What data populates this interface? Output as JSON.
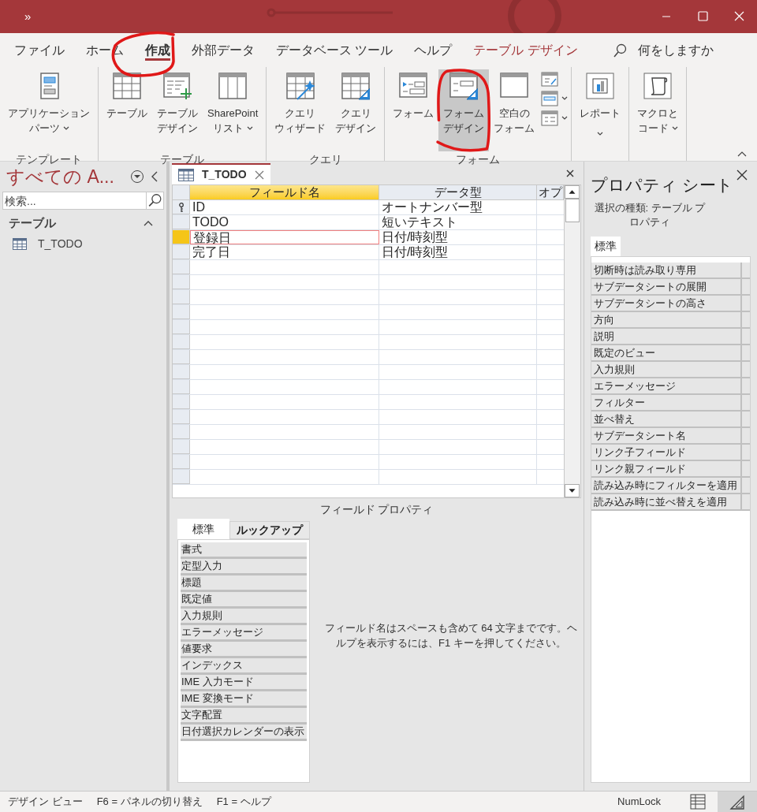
{
  "title_bar": {
    "quick_access": "»"
  },
  "ribbon_tabs": [
    {
      "label": "ファイル",
      "selected": false,
      "kind": "normal"
    },
    {
      "label": "ホーム",
      "selected": false,
      "kind": "normal"
    },
    {
      "label": "作成",
      "selected": true,
      "kind": "normal"
    },
    {
      "label": "外部データ",
      "selected": false,
      "kind": "normal"
    },
    {
      "label": "データベース ツール",
      "selected": false,
      "kind": "normal"
    },
    {
      "label": "ヘルプ",
      "selected": false,
      "kind": "normal"
    },
    {
      "label": "テーブル デザイン",
      "selected": false,
      "kind": "contextual"
    }
  ],
  "tell_me": "何をしますか",
  "ribbon_groups": [
    {
      "label": "テンプレート",
      "commands": [
        {
          "kind": "app-parts",
          "lines": [
            "アプリケーション",
            "パーツ"
          ],
          "dropdown": true,
          "highlighted": false
        }
      ]
    },
    {
      "label": "テーブル",
      "commands": [
        {
          "kind": "table",
          "lines": [
            "テーブル"
          ],
          "dropdown": false,
          "highlighted": false
        },
        {
          "kind": "table-design",
          "lines": [
            "テーブル",
            "デザイン"
          ],
          "dropdown": false,
          "highlighted": false
        },
        {
          "kind": "sharepoint",
          "lines": [
            "SharePoint",
            "リスト"
          ],
          "dropdown": true,
          "highlighted": false
        }
      ]
    },
    {
      "label": "クエリ",
      "commands": [
        {
          "kind": "query-wizard",
          "lines": [
            "クエリ",
            "ウィザード"
          ],
          "dropdown": false,
          "highlighted": false
        },
        {
          "kind": "query-design",
          "lines": [
            "クエリ",
            "デザイン"
          ],
          "dropdown": false,
          "highlighted": false
        }
      ]
    },
    {
      "label": "フォーム",
      "commands": [
        {
          "kind": "form",
          "lines": [
            "フォーム"
          ],
          "dropdown": false,
          "highlighted": false
        },
        {
          "kind": "form-design",
          "lines": [
            "フォーム",
            "デザイン"
          ],
          "dropdown": false,
          "highlighted": true
        },
        {
          "kind": "blank-form",
          "lines": [
            "空白の",
            "フォーム"
          ],
          "dropdown": false,
          "highlighted": false
        },
        {
          "kind": "small-stack",
          "dropdown": true,
          "highlighted": false
        }
      ]
    },
    {
      "commands": [
        {
          "kind": "report",
          "lines": [
            "レポート"
          ],
          "dropdown": true,
          "highlighted": false
        }
      ]
    },
    {
      "commands": [
        {
          "kind": "macro",
          "lines": [
            "マクロと",
            "コード"
          ],
          "dropdown": true,
          "highlighted": false
        }
      ]
    }
  ],
  "nav_pane": {
    "title": "すべての A...",
    "search": {
      "placeholder": "検索..."
    },
    "section": "テーブル",
    "items": [
      "T_TODO"
    ]
  },
  "document": {
    "tab": "T_TODO",
    "columns": [
      "フィールド名",
      "データ型",
      "オプ"
    ],
    "rows": [
      {
        "field": "ID",
        "type": "オートナンバー型",
        "primary_key": true,
        "current": false
      },
      {
        "field": "TODO",
        "type": "短いテキスト",
        "primary_key": false,
        "current": false
      },
      {
        "field": "登録日",
        "type": "日付/時刻型",
        "primary_key": false,
        "current": true
      },
      {
        "field": "完了日",
        "type": "日付/時刻型",
        "primary_key": false,
        "current": false
      }
    ],
    "field_properties": {
      "title": "フィールド プロパティ",
      "tabs": [
        {
          "label": "標準",
          "selected": true
        },
        {
          "label": "ルックアップ",
          "selected": false
        }
      ],
      "properties": [
        "書式",
        "定型入力",
        "標題",
        "既定値",
        "入力規則",
        "エラーメッセージ",
        "値要求",
        "インデックス",
        "IME 入力モード",
        "IME 変換モード",
        "文字配置",
        "日付選択カレンダーの表示"
      ],
      "help_text": "フィールド名はスペースも含めて 64 文字までです。ヘルプを表示するには、F1 キーを押してください。"
    }
  },
  "property_sheet": {
    "title": "プロパティ シート",
    "selection_type": "選択の種類: テーブル プロパティ",
    "tabs": [
      {
        "label": "標準",
        "selected": true
      }
    ],
    "properties": [
      "切断時は読み取り専用",
      "サブデータシートの展開",
      "サブデータシートの高さ",
      "方向",
      "説明",
      "既定のビュー",
      "入力規則",
      "エラーメッセージ",
      "フィルター",
      "並べ替え",
      "サブデータシート名",
      "リンク子フィールド",
      "リンク親フィールド",
      "読み込み時にフィルターを適用",
      "読み込み時に並べ替えを適用"
    ]
  },
  "status_bar": {
    "texts": [
      "デザイン ビュー",
      "F6 = パネルの切り替え",
      "F1 = ヘルプ"
    ],
    "indicator": "NumLock",
    "views": [
      {
        "kind": "datasheet",
        "selected": false
      },
      {
        "kind": "design",
        "selected": true
      }
    ]
  }
}
